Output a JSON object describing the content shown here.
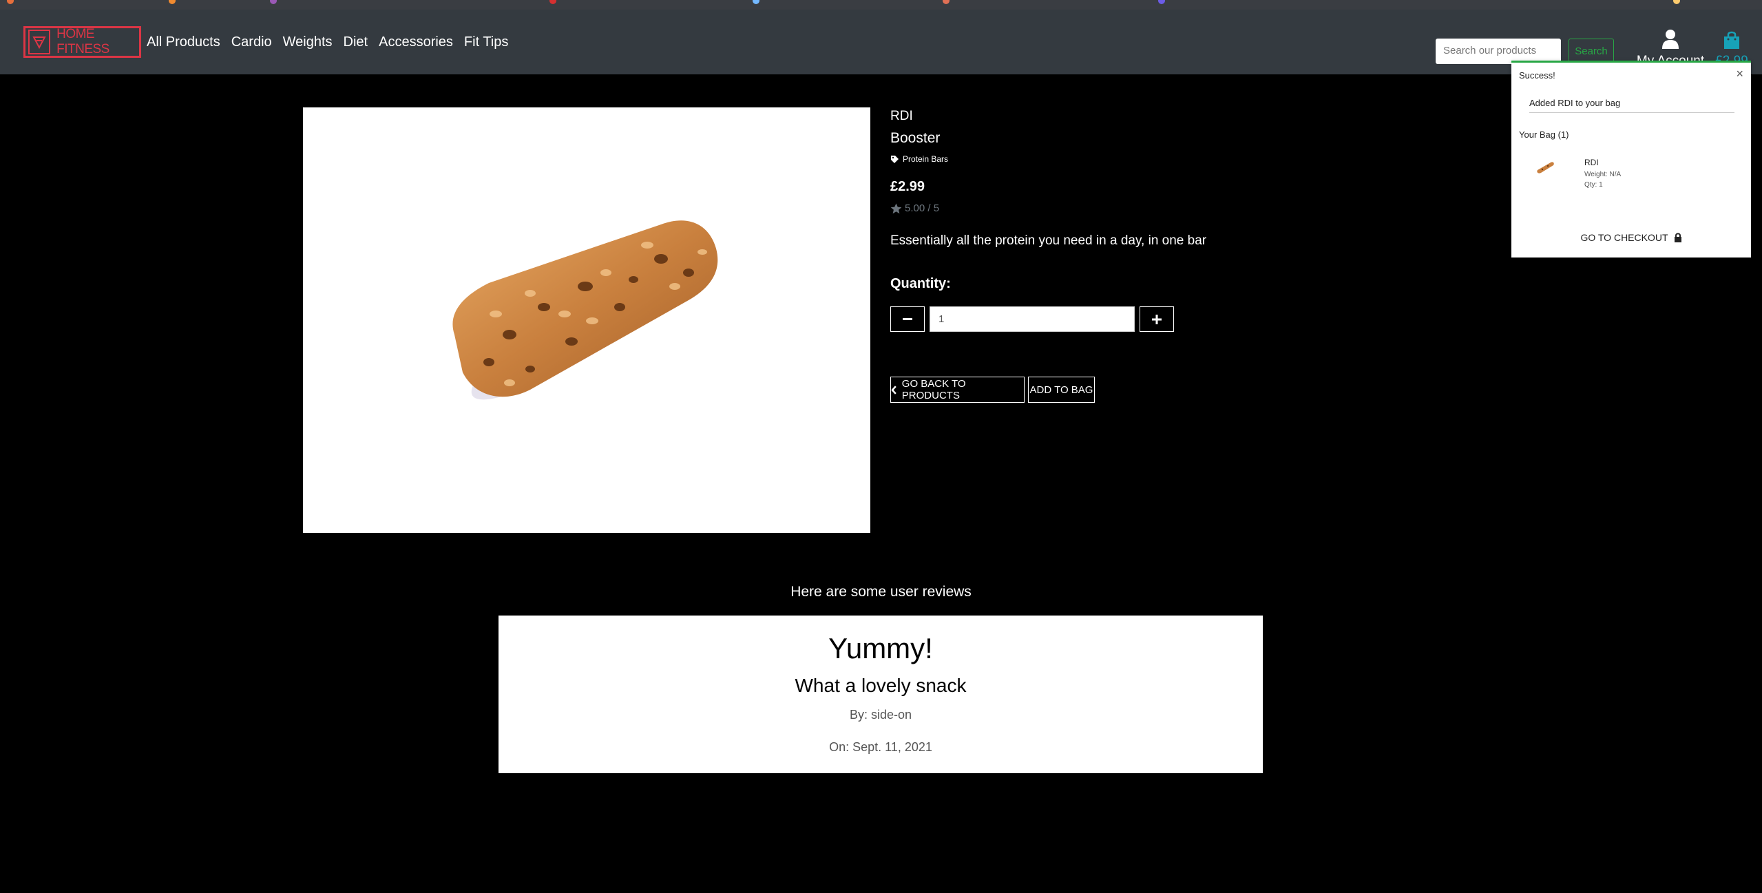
{
  "header": {
    "brand": "HOME FITNESS",
    "nav": [
      "All Products",
      "Cardio",
      "Weights",
      "Diet",
      "Accessories",
      "Fit Tips"
    ],
    "search_placeholder": "Search our products",
    "search_button": "Search",
    "account_label": "My Account",
    "bag_total": "£2.99"
  },
  "product": {
    "brand": "RDI",
    "name": "Booster",
    "category": "Protein Bars",
    "price": "£2.99",
    "rating": "5.00 / 5",
    "description": "Essentially all the protein you need in a day, in one bar",
    "quantity_label": "Quantity:",
    "quantity_value": "1",
    "back_button": "GO BACK TO PRODUCTS",
    "add_button": "ADD TO BAG"
  },
  "reviews": {
    "heading": "Here are some user reviews",
    "items": [
      {
        "title": "Yummy!",
        "body": "What a lovely snack",
        "by": "By: side-on",
        "on": "On: Sept. 11, 2021"
      }
    ]
  },
  "toast": {
    "title": "Success!",
    "close": "×",
    "message": "Added RDI to your bag",
    "bag_label": "Your Bag (1)",
    "item_name": "RDI",
    "item_weight": "Weight: N/A",
    "item_qty": "Qty: 1",
    "checkout": "GO TO CHECKOUT"
  },
  "colors": {
    "navbar": "#343a40",
    "brand_red": "#dc3545",
    "search_green": "#28a745",
    "bag_blue": "#17a2b8"
  },
  "icons": [
    "brand-logo-icon",
    "user-icon",
    "shopping-bag-icon",
    "tag-icon",
    "star-icon",
    "minus-icon",
    "plus-icon",
    "chevron-left-icon",
    "lock-icon"
  ]
}
